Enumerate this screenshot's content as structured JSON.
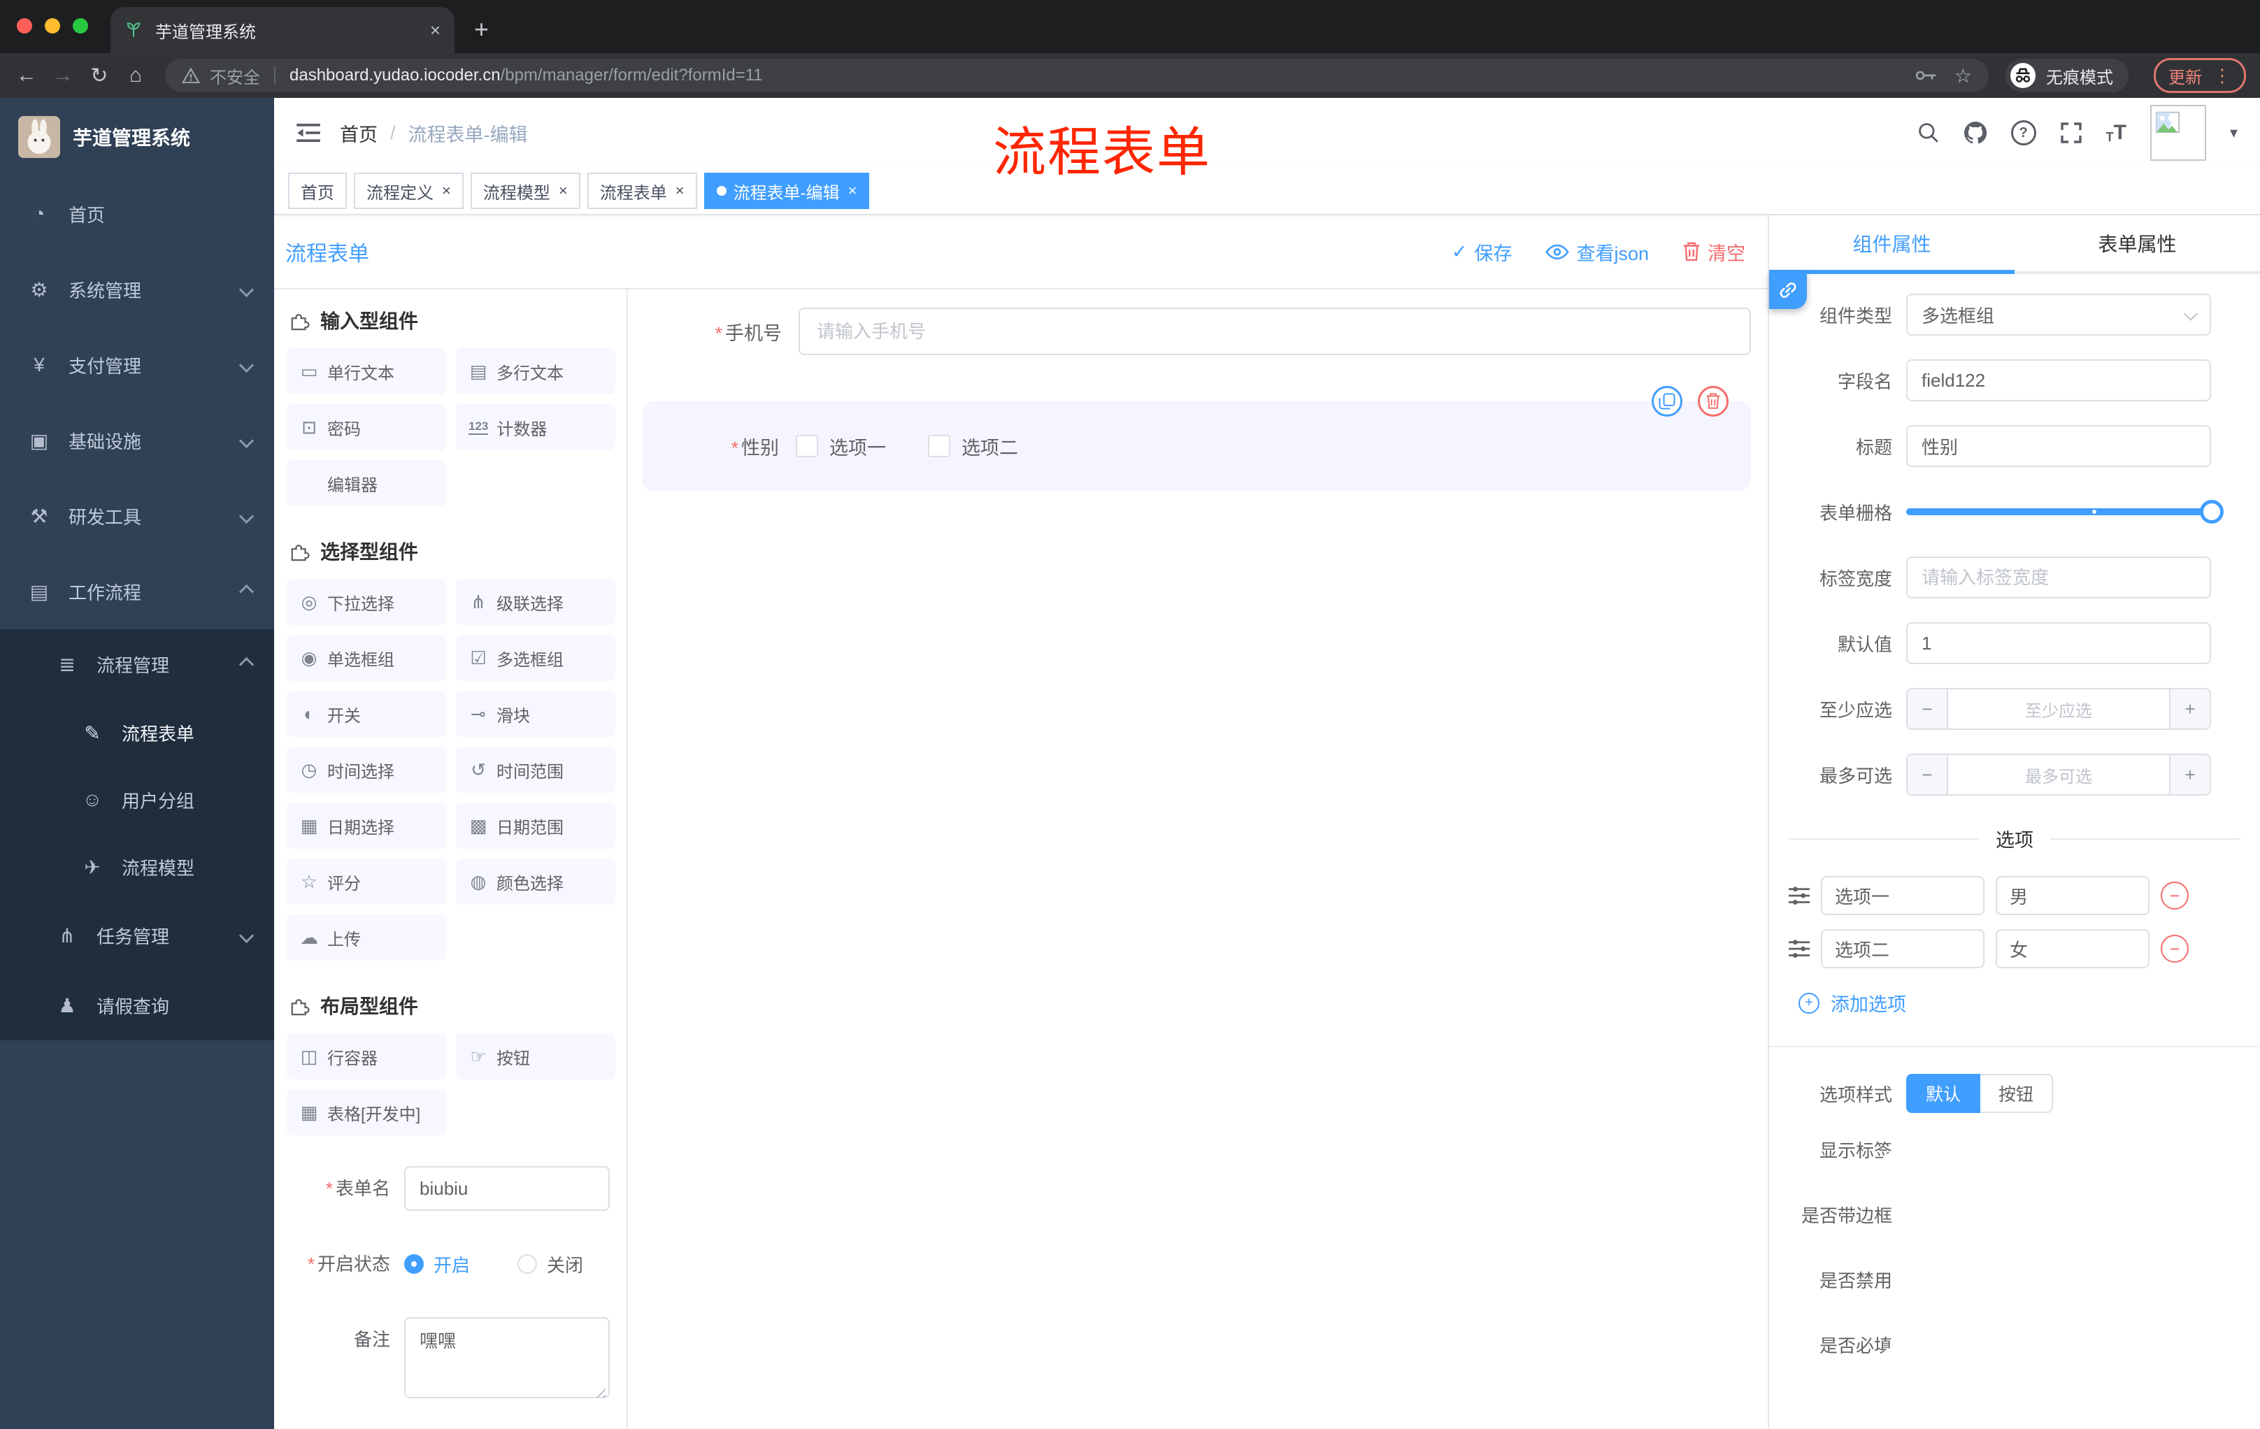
{
  "ui": {
    "close": "×",
    "plus": "+",
    "minus": "−",
    "check": "✓",
    "back": "←",
    "forward": "→",
    "reload": "↻",
    "home": "⌂",
    "star": "☆",
    "caret": "▾",
    "menu_dots": "⋮",
    "question": "?"
  },
  "browser": {
    "tab_title": "芋道管理系统",
    "security_label": "不安全",
    "url_host": "dashboard.yudao.iocoder.cn",
    "url_path": "/bpm/manager/form/edit?formId=11",
    "incognito_label": "无痕模式",
    "update_label": "更新"
  },
  "annotation_text": "流程表单",
  "sidebar": {
    "logo_title": "芋道管理系统",
    "items": [
      {
        "icon": "◔",
        "label": "首页"
      },
      {
        "icon": "⚙",
        "label": "系统管理"
      },
      {
        "icon": "¥",
        "label": "支付管理"
      },
      {
        "icon": "▣",
        "label": "基础设施"
      },
      {
        "icon": "⚒",
        "label": "研发工具"
      },
      {
        "icon": "▤",
        "label": "工作流程"
      }
    ],
    "submenu": {
      "parent": {
        "icon": "≣",
        "label": "流程管理"
      },
      "children": [
        {
          "icon": "✎",
          "label": "流程表单"
        },
        {
          "icon": "☺",
          "label": "用户分组"
        },
        {
          "icon": "✈",
          "label": "流程模型"
        }
      ],
      "siblings": [
        {
          "icon": "⋔",
          "label": "任务管理"
        },
        {
          "icon": "♟",
          "label": "请假查询"
        }
      ]
    }
  },
  "header": {
    "breadcrumb_root": "首页",
    "breadcrumb_sep": "/",
    "breadcrumb_current": "流程表单-编辑"
  },
  "tags": [
    {
      "label": "首页"
    },
    {
      "label": "流程定义"
    },
    {
      "label": "流程模型"
    },
    {
      "label": "流程表单"
    },
    {
      "label": "流程表单-编辑"
    }
  ],
  "toolbar": {
    "title": "流程表单",
    "save": "保存",
    "view_json": "查看json",
    "clear": "清空"
  },
  "palette": {
    "sections": [
      {
        "title": "输入型组件",
        "items": [
          {
            "icon": "▭",
            "label": "单行文本"
          },
          {
            "icon": "▤",
            "label": "多行文本"
          },
          {
            "icon": "⊡",
            "label": "密码"
          },
          {
            "icon": "123",
            "label": "计数器"
          },
          {
            "icon": "",
            "label": "编辑器"
          }
        ]
      },
      {
        "title": "选择型组件",
        "items": [
          {
            "icon": "◎",
            "label": "下拉选择"
          },
          {
            "icon": "⋔",
            "label": "级联选择"
          },
          {
            "icon": "◉",
            "label": "单选框组"
          },
          {
            "icon": "☑",
            "label": "多选框组"
          },
          {
            "icon": "◐",
            "label": "开关"
          },
          {
            "icon": "⊸",
            "label": "滑块"
          },
          {
            "icon": "◷",
            "label": "时间选择"
          },
          {
            "icon": "↺",
            "label": "时间范围"
          },
          {
            "icon": "▦",
            "label": "日期选择"
          },
          {
            "icon": "▩",
            "label": "日期范围"
          },
          {
            "icon": "☆",
            "label": "评分"
          },
          {
            "icon": "◍",
            "label": "颜色选择"
          },
          {
            "icon": "☁",
            "label": "上传"
          }
        ]
      },
      {
        "title": "布局型组件",
        "items": [
          {
            "icon": "◫",
            "label": "行容器"
          },
          {
            "icon": "☞",
            "label": "按钮"
          },
          {
            "icon": "▦",
            "label": "表格[开发中]"
          }
        ]
      }
    ]
  },
  "meta_form": {
    "name_label": "表单名",
    "name_value": "biubiu",
    "status_label": "开启状态",
    "status_on": "开启",
    "status_off": "关闭",
    "remark_label": "备注",
    "remark_value": "嘿嘿"
  },
  "canvas": {
    "phone": {
      "label": "手机号",
      "placeholder": "请输入手机号"
    },
    "gender": {
      "label": "性别",
      "option1": "选项一",
      "option2": "选项二"
    }
  },
  "props": {
    "tab_component": "组件属性",
    "tab_form": "表单属性",
    "component_type_label": "组件类型",
    "component_type_value": "多选框组",
    "field_name_label": "字段名",
    "field_name_value": "field122",
    "title_label": "标题",
    "title_value": "性别",
    "grid_label": "表单栅格",
    "label_width_label": "标签宽度",
    "label_width_placeholder": "请输入标签宽度",
    "default_label": "默认值",
    "default_value": "1",
    "min_label": "至少应选",
    "min_placeholder": "至少应选",
    "max_label": "最多可选",
    "max_placeholder": "最多可选",
    "options_title": "选项",
    "options": [
      {
        "label": "选项一",
        "value": "男"
      },
      {
        "label": "选项二",
        "value": "女"
      }
    ],
    "add_option": "添加选项",
    "style_label": "选项样式",
    "style_default": "默认",
    "style_button": "按钮",
    "toggle_show_label": "显示标签",
    "toggle_border": "是否带边框",
    "toggle_disabled": "是否禁用",
    "toggle_required": "是否必填"
  },
  "colors": {
    "accent": "#409EFF",
    "danger": "#F56C6C",
    "annotation_red": "#FF2600",
    "sidebar_bg": "#304156",
    "submenu_bg": "#1F2D3D"
  }
}
